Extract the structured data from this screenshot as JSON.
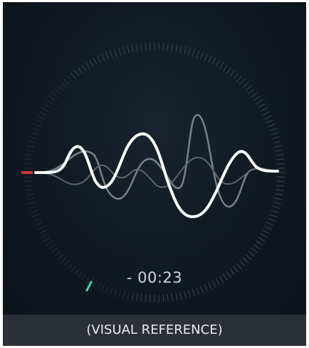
{
  "player": {
    "time_remaining": "- 00:23",
    "progress_fraction": 0.08
  },
  "caption": "(VISUAL REFERENCE)",
  "colors": {
    "background": "#0f1620",
    "waveform_primary": "#ffffff",
    "waveform_secondary": "#8a8f96",
    "ring": "#3a424c",
    "playhead_marker": "#d3333c",
    "progress_marker": "#3ddca0"
  }
}
